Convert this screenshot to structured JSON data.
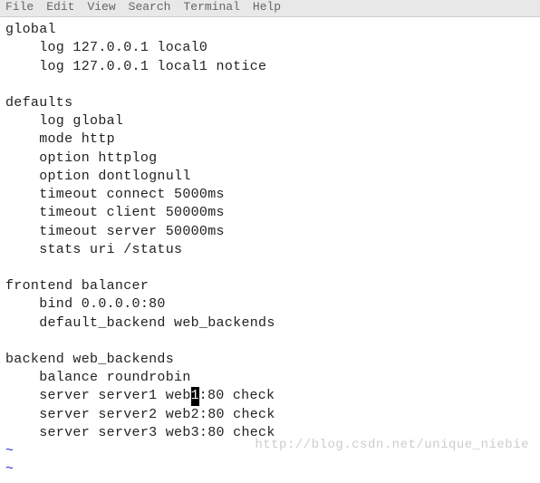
{
  "menubar": {
    "items": [
      "File",
      "Edit",
      "View",
      "Search",
      "Terminal",
      "Help"
    ]
  },
  "editor": {
    "lines": [
      {
        "text": "global",
        "indent": 0
      },
      {
        "text": "log 127.0.0.1 local0",
        "indent": 1
      },
      {
        "text": "log 127.0.0.1 local1 notice",
        "indent": 1
      },
      {
        "text": "",
        "indent": 0
      },
      {
        "text": "defaults",
        "indent": 0
      },
      {
        "text": "log global",
        "indent": 1
      },
      {
        "text": "mode http",
        "indent": 1
      },
      {
        "text": "option httplog",
        "indent": 1
      },
      {
        "text": "option dontlognull",
        "indent": 1
      },
      {
        "text": "timeout connect 5000ms",
        "indent": 1
      },
      {
        "text": "timeout client 50000ms",
        "indent": 1
      },
      {
        "text": "timeout server 50000ms",
        "indent": 1
      },
      {
        "text": "stats uri /status",
        "indent": 1
      },
      {
        "text": "",
        "indent": 0
      },
      {
        "text": "frontend balancer",
        "indent": 0
      },
      {
        "text": "bind 0.0.0.0:80",
        "indent": 1
      },
      {
        "text": "default_backend web_backends",
        "indent": 1
      },
      {
        "text": "",
        "indent": 0
      },
      {
        "text": "backend web_backends",
        "indent": 0
      },
      {
        "text": "balance roundrobin",
        "indent": 1
      },
      {
        "text": "server server1 web",
        "indent": 1,
        "cursor_char": "1",
        "after_cursor": ":80 check"
      },
      {
        "text": "server server2 web2:80 check",
        "indent": 1
      },
      {
        "text": "server server3 web3:80 check",
        "indent": 1
      }
    ],
    "tildes": [
      "~",
      "~"
    ]
  },
  "watermark": "http://blog.csdn.net/unique_niebie",
  "indent_str": "    "
}
